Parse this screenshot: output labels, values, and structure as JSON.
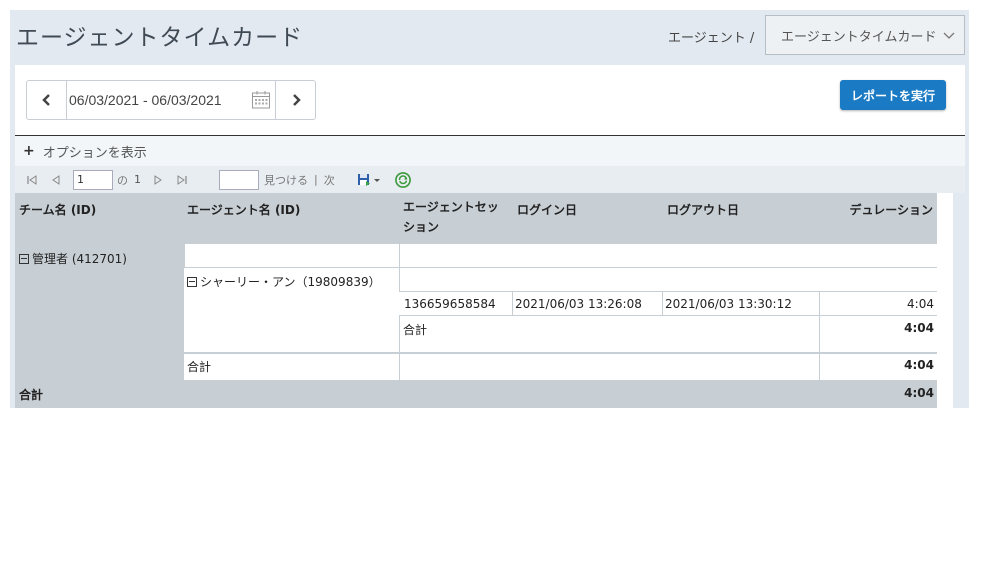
{
  "header": {
    "title": "エージェントタイムカード",
    "breadcrumb": "エージェント /",
    "report_selector": "エージェントタイムカード"
  },
  "toolbar": {
    "date_range": "06/03/2021 - 06/03/2021",
    "run_button": "レポートを実行",
    "options_label": "オプションを表示"
  },
  "pager": {
    "page_value": "1",
    "of_label": "の",
    "total_pages": "1",
    "find_label": "見つける",
    "separator": "|",
    "next_label": "次"
  },
  "report": {
    "columns": [
      "チーム名 (ID)",
      "エージェント名 (ID)",
      "エージェントセッション",
      "ログイン日",
      "ログアウト日",
      "デュレーション"
    ],
    "team": "管理者 (412701)",
    "agent": "シャーリー・アン（19809839）",
    "session": {
      "id": "136659658584",
      "login": "2021/06/03 13:26:08",
      "logout": "2021/06/03 13:30:12",
      "duration": "4:04"
    },
    "agent_subtotal_label": "合計",
    "agent_subtotal": "4:04",
    "team_subtotal_label": "合計",
    "team_subtotal": "4:04",
    "grand_total_label": "合計",
    "grand_total": "4:04"
  },
  "colors": {
    "accent": "#1a7ac3",
    "header_bg": "#e3e9f0",
    "table_header_bg": "#c8cfd4"
  }
}
